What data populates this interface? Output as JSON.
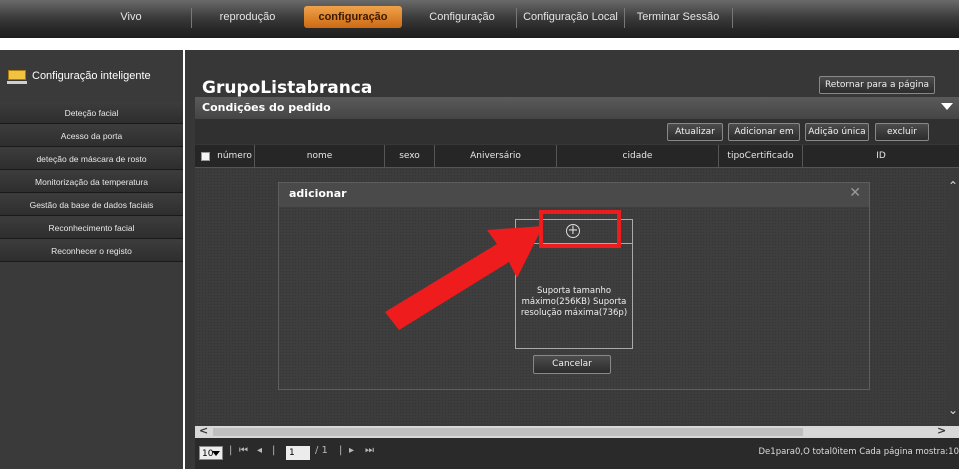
{
  "nav": {
    "tabs": [
      {
        "label": "Vivo",
        "active": false
      },
      {
        "label": "reprodução",
        "active": false
      },
      {
        "label": "configuração",
        "active": true
      },
      {
        "label": "Configuração",
        "active": false
      },
      {
        "label": "Configuração Local",
        "active": false
      },
      {
        "label": "Terminar Sessão",
        "active": false
      }
    ]
  },
  "sidebar": {
    "title": "Configuração inteligente",
    "icon": "folder-icon",
    "items": [
      "Deteção facial",
      "Acesso da porta",
      "deteção de máscara de rosto",
      "Monitorização da temperatura",
      "Gestão da base de dados faciais",
      "Reconhecimento facial",
      "Reconhecer o registo"
    ]
  },
  "main": {
    "title": "GrupoListabranca",
    "return_button": "Retornar para a página",
    "conditions_label": "Condições do pedido",
    "toolbar": {
      "refresh": "Atualizar",
      "add_batch": "Adicionar em",
      "add_single": "Adição única",
      "delete": "excluir"
    },
    "columns": [
      "número",
      "nome",
      "sexo",
      "Aniversário",
      "cidade",
      "tipoCertificado",
      "ID"
    ],
    "pager": {
      "page_size": "10",
      "current_page": "1",
      "total_pages": "/ 1",
      "info": "De1para0,O total0item Cada página mostra:10"
    }
  },
  "modal": {
    "title": "adicionar",
    "upload_hint": "Suporta tamanho máximo(256KB) Suporta resolução máxima(736p)",
    "cancel": "Cancelar"
  },
  "colors": {
    "active_tab": "#e0893a",
    "annotation": "#ee1c1c",
    "panel_bg": "#373737"
  }
}
